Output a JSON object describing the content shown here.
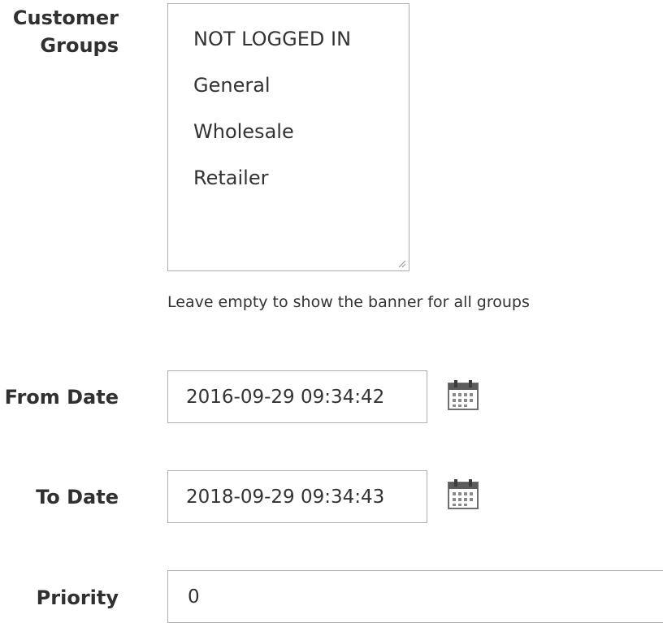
{
  "customer_groups": {
    "label_line1": "Customer",
    "label_line2": "Groups",
    "options": [
      "NOT LOGGED IN",
      "General",
      "Wholesale",
      "Retailer"
    ],
    "note": "Leave empty to show the banner for all groups"
  },
  "from_date": {
    "label": "From Date",
    "value": "2016-09-29 09:34:42",
    "calendar_icon": "calendar-icon"
  },
  "to_date": {
    "label": "To Date",
    "value": "2018-09-29 09:34:43",
    "calendar_icon": "calendar-icon"
  },
  "priority": {
    "label": "Priority",
    "value": "0"
  },
  "colors": {
    "border": "#adadad",
    "label_text": "#303030",
    "body_text": "#333333"
  }
}
